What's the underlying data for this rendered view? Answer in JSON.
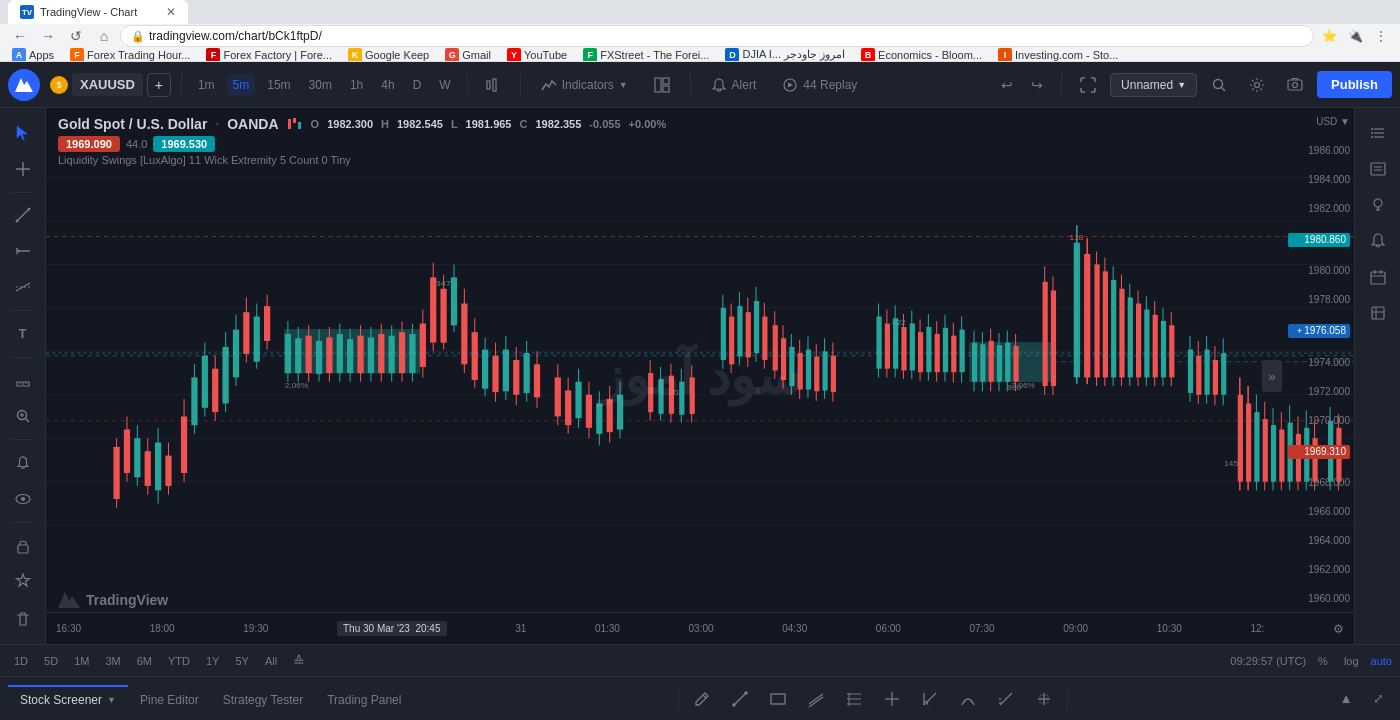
{
  "browser": {
    "url": "tradingview.com/chart/bCk1ftpD/",
    "back_btn": "←",
    "forward_btn": "→",
    "refresh_btn": "↺",
    "home_btn": "⌂"
  },
  "bookmarks": [
    {
      "label": "Apps",
      "color": "#4285F4"
    },
    {
      "label": "Forex Trading Hour...",
      "color": "#ff6600"
    },
    {
      "label": "Forex Factory | Fore...",
      "color": "#cc0000"
    },
    {
      "label": "Google Keep",
      "color": "#f4b400"
    },
    {
      "label": "Gmail",
      "color": "#EA4335"
    },
    {
      "label": "YouTube",
      "color": "#FF0000"
    },
    {
      "label": "FXStreet - The Forei...",
      "color": "#00a651"
    },
    {
      "label": "DJIA I... امروز جاودجر",
      "color": "#0066cc"
    },
    {
      "label": "Economics - Bloom...",
      "color": "#ff0000"
    },
    {
      "label": "Investing.com - Sto...",
      "color": "#e65100"
    }
  ],
  "chart": {
    "symbol": "XAUUSD",
    "instrument": "Gold Spot / U.S. Dollar",
    "broker": "OANDA",
    "currency": "USD",
    "timeframes": [
      "1m",
      "5m",
      "15m",
      "30m",
      "1h",
      "4h",
      "D",
      "W"
    ],
    "active_timeframe": "5m",
    "ohlc": {
      "open_label": "O",
      "open": "1982.300",
      "high_label": "H",
      "high": "1982.545",
      "low_label": "L",
      "low": "1981.965",
      "close_label": "C",
      "close": "1982.355",
      "change": "-0.055",
      "change_pct": "+0.00%"
    },
    "price_badges": {
      "low_price": "1969.090",
      "count": "44.0",
      "high_price": "1969.530"
    },
    "indicator": "Liquidity Swings [LuxAlgo]  11  Wick Extremity 5  Count 0  Tiny",
    "watermark": "سود آموز",
    "current_price": "1976.058",
    "price_levels": [
      "1986.000",
      "1984.000",
      "1982.000",
      "1980.860",
      "1980.000",
      "1978.000",
      "1976.058",
      "1974.000",
      "1972.000",
      "1970.000",
      "1969.310",
      "1968.000",
      "1966.000",
      "1964.000",
      "1962.000",
      "1960.000"
    ],
    "time_labels": [
      "16:30",
      "18:00",
      "19:30",
      "Thu 30 Mar '23  20:45",
      "31",
      "01:30",
      "03:00",
      "04:30",
      "06:00",
      "07:30",
      "09:00",
      "10:30",
      "12:"
    ],
    "active_time": "Thu 30 Mar '23  20:45",
    "time_display": "09:29:57 (UTC)"
  },
  "toolbar": {
    "indicators_label": "Indicators",
    "alert_label": "Alert",
    "replay_label": "44 Replay",
    "unnamed_label": "Unnamed",
    "publish_label": "Publish"
  },
  "bottom_tabs": [
    {
      "label": "Stock Screener",
      "has_dropdown": true
    },
    {
      "label": "Pine Editor"
    },
    {
      "label": "Strategy Tester"
    },
    {
      "label": "Trading Panel"
    }
  ],
  "periods": [
    "1D",
    "5D",
    "1M",
    "3M",
    "6M",
    "YTD",
    "1Y",
    "5Y",
    "All"
  ],
  "icons": {
    "cursor": "↖",
    "crosshair": "+",
    "text": "T",
    "ruler": "📏",
    "trend_line": "╱",
    "brush": "✏",
    "measure": "↔",
    "zoom": "🔍",
    "alerts": "🔔",
    "watch": "👁",
    "replay": "▶"
  }
}
